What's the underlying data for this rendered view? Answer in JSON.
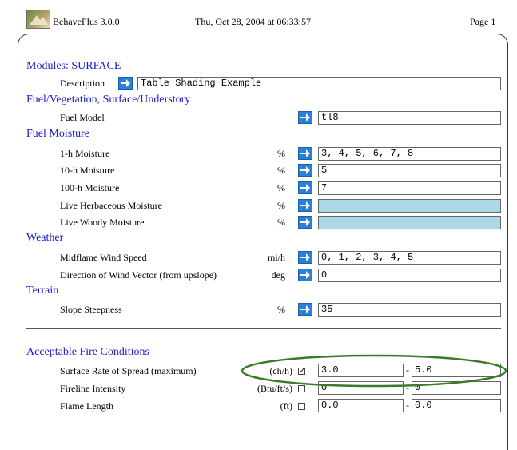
{
  "header": {
    "app": "BehavePlus 3.0.0",
    "datetime": "Thu, Oct 28, 2004 at 06:33:57",
    "page": "Page 1"
  },
  "modules": {
    "title": "Modules: SURFACE",
    "description_label": "Description",
    "description_value": "Table Shading Example"
  },
  "fuel_veg": {
    "title": "Fuel/Vegetation, Surface/Understory",
    "fuel_model_label": "Fuel Model",
    "fuel_model_value": "tl8"
  },
  "fuel_moisture": {
    "title": "Fuel Moisture",
    "rows": [
      {
        "label": "1-h Moisture",
        "unit": "%",
        "value": "3, 4, 5, 6, 7, 8"
      },
      {
        "label": "10-h Moisture",
        "unit": "%",
        "value": "5"
      },
      {
        "label": "100-h Moisture",
        "unit": "%",
        "value": "7"
      },
      {
        "label": "Live Herbaceous Moisture",
        "unit": "%",
        "value": ""
      },
      {
        "label": "Live Woody Moisture",
        "unit": "%",
        "value": ""
      }
    ]
  },
  "weather": {
    "title": "Weather",
    "rows": [
      {
        "label": "Midflame Wind Speed",
        "unit": "mi/h",
        "value": "0, 1, 2, 3, 4, 5"
      },
      {
        "label": "Direction of Wind Vector (from upslope)",
        "unit": "deg",
        "value": "0"
      }
    ]
  },
  "terrain": {
    "title": "Terrain",
    "rows": [
      {
        "label": "Slope Steepness",
        "unit": "%",
        "value": "35"
      }
    ]
  },
  "acceptable": {
    "title": "Acceptable Fire Conditions",
    "rows": [
      {
        "label": "Surface Rate of Spread (maximum)",
        "unit": "(ch/h)",
        "checked": true,
        "min": "3.0",
        "max": "5.0",
        "sep": "-"
      },
      {
        "label": "Fireline Intensity",
        "unit": "(Btu/ft/s)",
        "checked": false,
        "min": "0",
        "max": "0",
        "sep": "-"
      },
      {
        "label": "Flame Length",
        "unit": "(ft)",
        "checked": false,
        "min": "0.0",
        "max": "0.0",
        "sep": "-"
      }
    ]
  },
  "colors": {
    "section": "#1a1acf",
    "arrow": "#2a7fd8",
    "highlight_ellipse": "#3a7a2a",
    "empty_field": "#add8e6"
  }
}
